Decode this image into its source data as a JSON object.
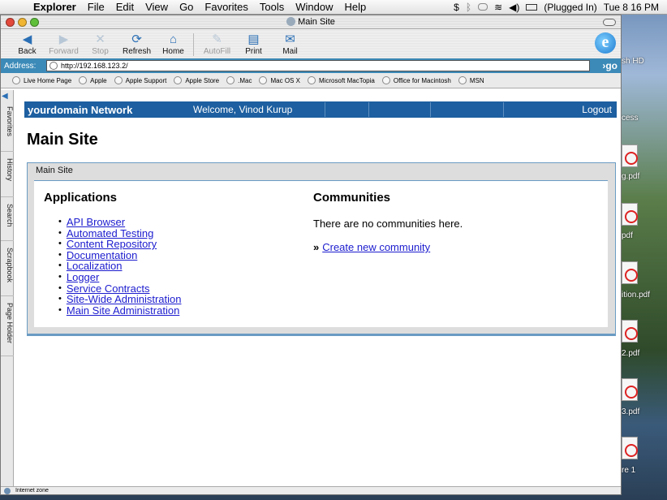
{
  "menubar": {
    "app": "Explorer",
    "items": [
      "File",
      "Edit",
      "View",
      "Go",
      "Favorites",
      "Tools",
      "Window",
      "Help"
    ],
    "battery": "(Plugged In)",
    "clock": "Tue 8 16 PM"
  },
  "window": {
    "title": "Main Site"
  },
  "toolbar": {
    "back": "Back",
    "forward": "Forward",
    "stop": "Stop",
    "refresh": "Refresh",
    "home": "Home",
    "autofill": "AutoFill",
    "print": "Print",
    "mail": "Mail"
  },
  "address": {
    "label": "Address:",
    "url": "http://192.168.123.2/",
    "go": "go"
  },
  "favorites": [
    "Live Home Page",
    "Apple",
    "Apple Support",
    "Apple Store",
    ".Mac",
    "Mac OS X",
    "Microsoft MacTopia",
    "Office for Macintosh",
    "MSN"
  ],
  "sidetabs": [
    "Favorites",
    "History",
    "Search",
    "Scrapbook",
    "Page Holder"
  ],
  "site": {
    "name": "yourdomain Network",
    "welcome": "Welcome, Vinod Kurup",
    "logout": "Logout",
    "page_title": "Main Site",
    "portal_label": "Main Site",
    "applications_title": "Applications",
    "applications": [
      "API Browser",
      "Automated Testing",
      "Content Repository",
      "Documentation",
      "Localization",
      "Logger",
      "Service Contracts",
      "Site-Wide Administration",
      "Main Site Administration"
    ],
    "communities_title": "Communities",
    "no_communities": "There are no communities here.",
    "create_community": "Create new community"
  },
  "status": {
    "zone": "Internet zone"
  },
  "desktop": {
    "labels": [
      "sh HD",
      "cess",
      "g.pdf",
      "pdf",
      "pdf",
      "ition.pdf",
      "2.pdf",
      "3.pdf",
      "re 1"
    ]
  }
}
